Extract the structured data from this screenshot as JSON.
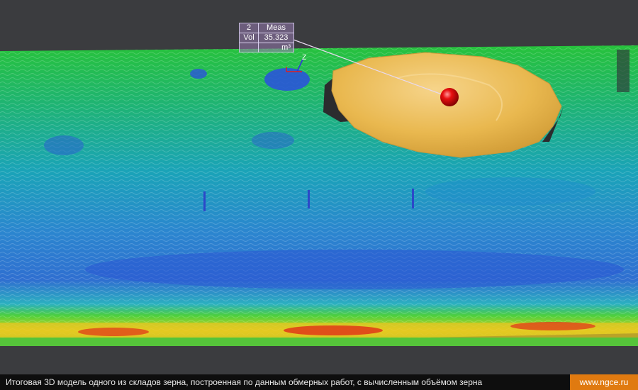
{
  "measurement": {
    "id": "2",
    "header": "Meas",
    "vol_label": "Vol",
    "vol_value": "35.323",
    "unit": "m³"
  },
  "axis_gizmo": {
    "z_label": "Z"
  },
  "caption": "Итоговая 3D модель одного из складов зерна, построенная по данным обмерных работ, с вычисленным объёмом зерна",
  "site": "www.ngce.ru",
  "colors": {
    "background": "#3b3c3f",
    "grain_pile": "#e8b64e",
    "marker": "#d40000",
    "accent": "#e07a10"
  }
}
